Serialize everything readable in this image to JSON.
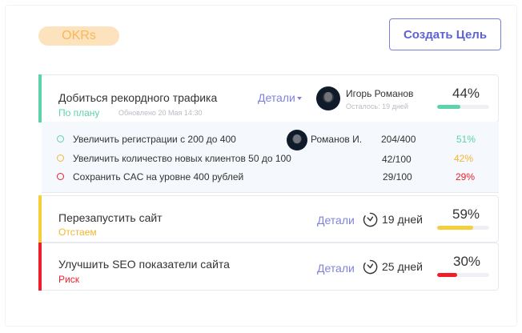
{
  "header": {
    "badge": "OKRs",
    "create_button": "Создать Цель"
  },
  "goals": [
    {
      "title": "Добиться рекордного трафика",
      "status": "По плану",
      "updated": "Обновлено 20 Мая 14:30",
      "details": "Детали",
      "owner": "Игорь Романов",
      "remaining": "Осталось: 19 дней",
      "percent": "44%",
      "progress": 0.44,
      "color": "#5cd3a8"
    },
    {
      "title": "Перезапустить сайт",
      "status": "Отстаем",
      "details": "Детали",
      "days": "19 дней",
      "percent": "59%",
      "progress": 0.69,
      "color": "#f5cf3a"
    },
    {
      "title": "Улучшить SEO показатели сайта",
      "status": "Риск",
      "details": "Детали",
      "days": "25 дней",
      "percent": "30%",
      "progress": 0.38,
      "color": "#ee1f2a"
    }
  ],
  "key_results": [
    {
      "title": "Увеличить регистрации с 200 до 400",
      "owner": "Романов И.",
      "value": "204/400",
      "percent": "51%",
      "color": "#5cd3a8"
    },
    {
      "title": "Увеличить количество новых клиентов 50 до 100",
      "value": "42/100",
      "percent": "42%",
      "color": "#f5b531"
    },
    {
      "title": "Сохранить CAC на уровне 400 рублей",
      "value": "29/100",
      "percent": "29%",
      "color": "#ee1f2a"
    }
  ],
  "colors": {
    "accent": "#5f63d1",
    "on_track": "#5cd3a8",
    "behind": "#f5cf3a",
    "risk": "#ee1f2a"
  },
  "icons": {
    "clock": "clock-icon",
    "caret": "chevron-down-icon"
  }
}
